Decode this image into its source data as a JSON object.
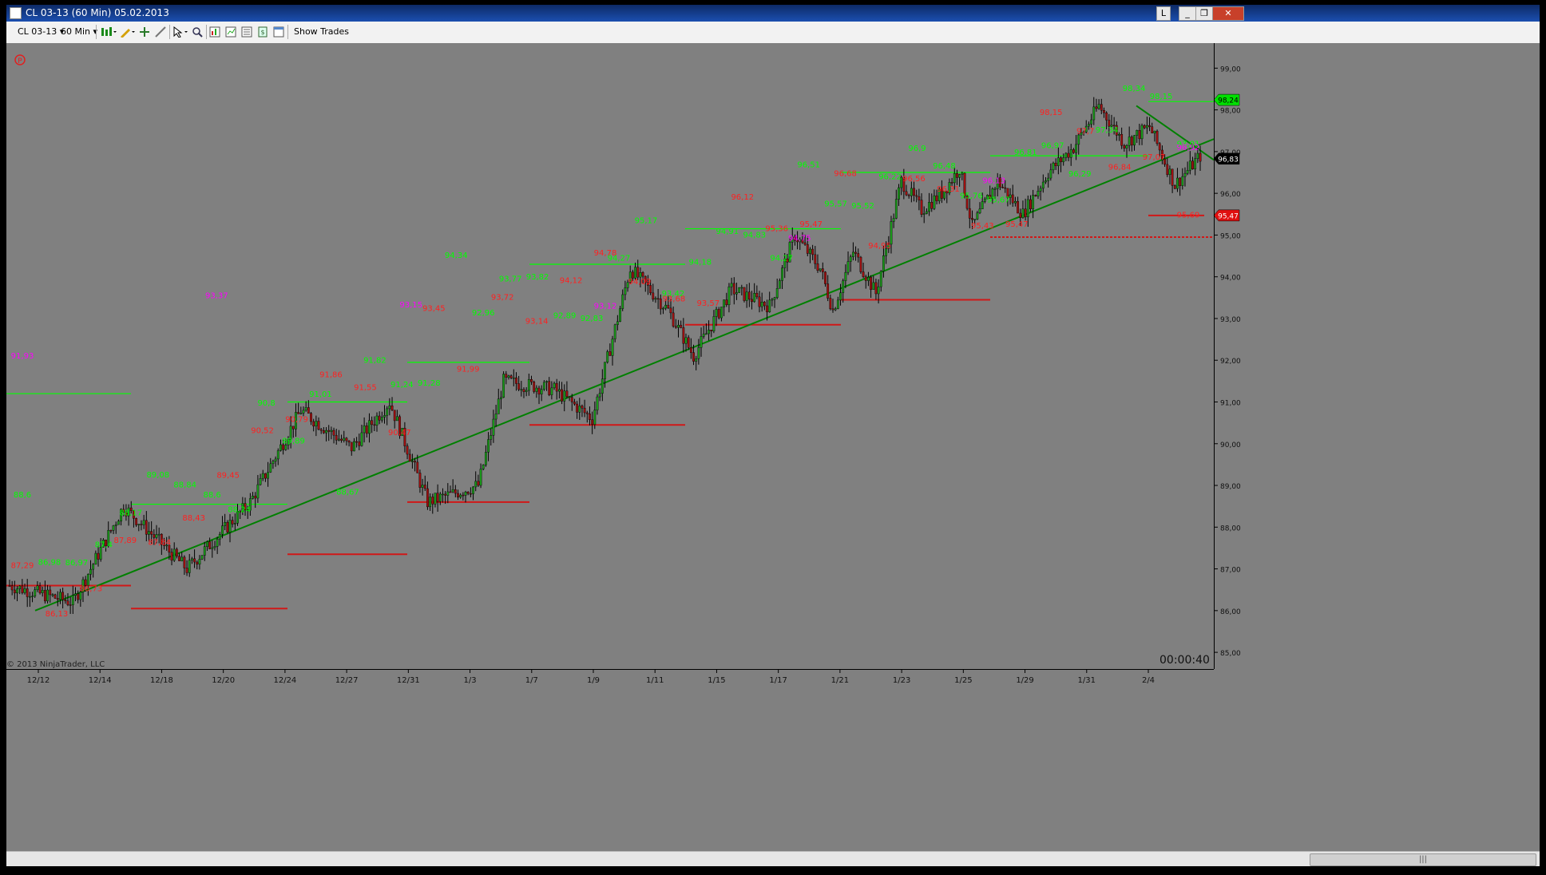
{
  "window": {
    "title": "CL 03-13 (60 Min)  05.02.2013",
    "buttons": [
      "L",
      "_",
      "❐",
      "✕"
    ]
  },
  "toolbar": {
    "instrument": "CL 03-13",
    "interval": "60 Min",
    "show_trades": "Show Trades"
  },
  "chart": {
    "copyright": "© 2013 NinjaTrader, LLC",
    "timer": "00:00:40",
    "p_marker": "P",
    "price_axis": [
      "99,00",
      "98,00",
      "97,00",
      "96,00",
      "95,00",
      "94,00",
      "93,00",
      "92,00",
      "91,00",
      "90,00",
      "89,00",
      "88,00",
      "87,00",
      "86,00",
      "85,00"
    ],
    "date_axis": [
      "12/12",
      "12/14",
      "12/18",
      "12/20",
      "12/24",
      "12/27",
      "12/31",
      "1/3",
      "1/7",
      "1/9",
      "1/11",
      "1/15",
      "1/17",
      "1/21",
      "1/23",
      "1/25",
      "1/29",
      "1/31",
      "2/4"
    ],
    "price_tags": [
      {
        "value": "98,24",
        "color": "#00e000",
        "text_color": "#000000"
      },
      {
        "value": "96,83",
        "color": "#000000",
        "text_color": "#ffffff"
      },
      {
        "value": "95,47",
        "color": "#e01010",
        "text_color": "#ffffff"
      }
    ],
    "colors": {
      "background": "#808080",
      "green": "#00ff00",
      "red": "#ff2020",
      "magenta": "#ff00ff",
      "trend": "#008000"
    }
  },
  "chart_data": {
    "type": "candlestick",
    "price_labels_green": [
      "88,6",
      "86,98",
      "86,97",
      "87,4",
      "88,17",
      "89,08",
      "88,84",
      "88,6",
      "88,24",
      "90,8",
      "89,89",
      "91,01",
      "88,67",
      "91,82",
      "91,24",
      "91,28",
      "94,34",
      "92,96",
      "93,77",
      "93,82",
      "92,89",
      "92,83",
      "94,27",
      "95,17",
      "93,42",
      "94,18",
      "94,91",
      "94,83",
      "94,27",
      "96,51",
      "95,57",
      "95,52",
      "96,22",
      "96,9",
      "96,48",
      "95,76",
      "95,67",
      "96,81",
      "96,97",
      "96,29",
      "97,34",
      "98,34",
      "98,15",
      "97,01"
    ],
    "price_labels_red": [
      "87,29",
      "86,13",
      "86,73",
      "87,89",
      "87,84",
      "88,43",
      "89,45",
      "90,52",
      "90,79",
      "91,86",
      "91,55",
      "90,47",
      "93,45",
      "91,99",
      "93,72",
      "93,14",
      "94,12",
      "94,78",
      "94,09",
      "93,68",
      "93,57",
      "96,12",
      "95,36",
      "95,47",
      "96,68",
      "94,95",
      "96,56",
      "96,31",
      "95,43",
      "95,47",
      "98,15",
      "97,7",
      "96,84",
      "97,07",
      "95,69"
    ],
    "price_labels_magenta": [
      "91,93",
      "93,37",
      "93,15",
      "93,12",
      "94,75",
      "96,13",
      "96,92"
    ],
    "ylim": [
      84.6,
      99.6
    ],
    "last_price": 96.83
  }
}
